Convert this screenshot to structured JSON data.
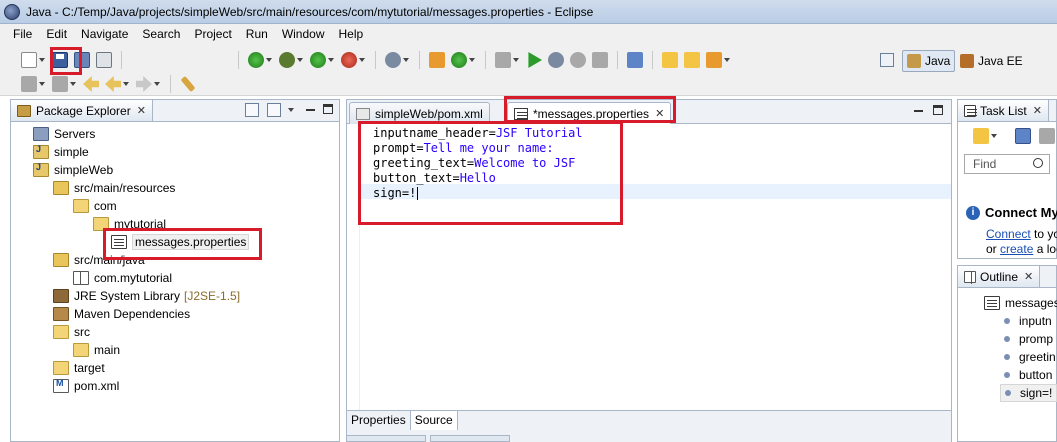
{
  "window": {
    "title": "Java - C:/Temp/Java/projects/simpleWeb/src/main/resources/com/mytutorial/messages.properties - Eclipse"
  },
  "menu": [
    "File",
    "Edit",
    "Navigate",
    "Search",
    "Project",
    "Run",
    "Window",
    "Help"
  ],
  "perspectives": {
    "java": "Java",
    "javaee": "Java EE"
  },
  "package_explorer": {
    "tab_label": "Package Explorer",
    "tree": {
      "servers": "Servers",
      "simple": "simple",
      "simpleweb": "simpleWeb",
      "src_main_resources": "src/main/resources",
      "com": "com",
      "mytutorial": "mytutorial",
      "messages_properties": "messages.properties",
      "src_main_java": "src/main/java",
      "com_mytutorial": "com.mytutorial",
      "jre_library": "JRE System Library",
      "jre_version": "[J2SE-1.5]",
      "maven_deps": "Maven Dependencies",
      "src": "src",
      "main": "main",
      "target": "target",
      "pom_xml": "pom.xml"
    }
  },
  "editor": {
    "tabs": [
      "simpleWeb/pom.xml",
      "*messages.properties"
    ],
    "lines": [
      {
        "key": "inputname_header=",
        "value": "JSF Tutorial"
      },
      {
        "key": "prompt=",
        "value": "Tell me your name:"
      },
      {
        "key": "greeting_text=",
        "value": "Welcome to JSF"
      },
      {
        "key": "button_text=",
        "value": "Hello"
      },
      {
        "key": "sign=!",
        "value": ""
      }
    ],
    "bottom_tabs": [
      "Properties",
      "Source"
    ]
  },
  "task_list": {
    "tab_label": "Task List",
    "find_placeholder": "Find",
    "connect_title": "Connect My",
    "connect_link": "Connect",
    "connect_text1": "to yo",
    "connect_or": "or",
    "connect_link2": "create",
    "connect_text2": "a loc"
  },
  "outline": {
    "tab_label": "Outline",
    "root": "messages.",
    "items": [
      "inputn",
      "promp",
      "greetin",
      "button",
      "sign=!"
    ]
  },
  "colors": {
    "highlight": "#d81b2a",
    "property_value": "#2a00ff"
  }
}
